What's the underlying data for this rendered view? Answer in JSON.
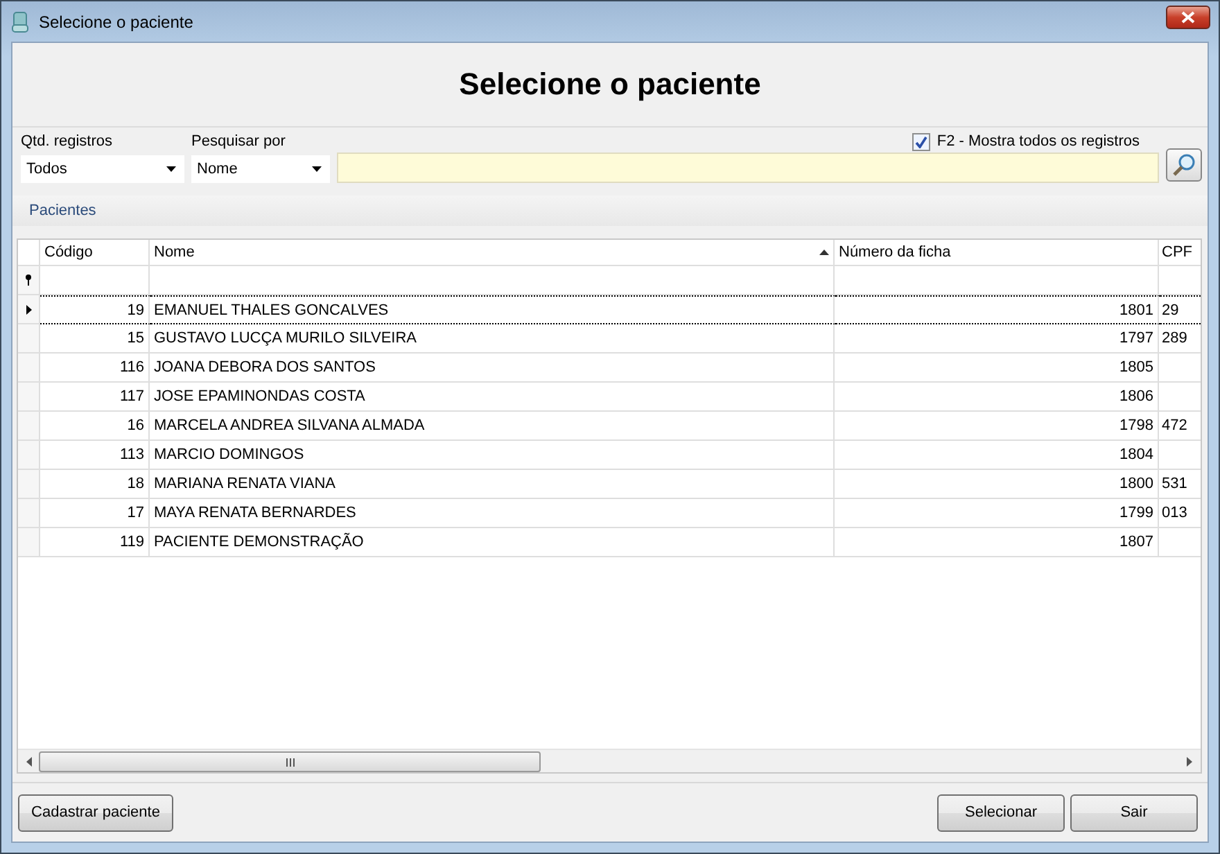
{
  "window": {
    "title": "Selecione o paciente"
  },
  "heading": "Selecione o paciente",
  "filters": {
    "count_label": "Qtd. registros",
    "count_value": "Todos",
    "search_by_label": "Pesquisar por",
    "search_by_value": "Nome",
    "show_all": {
      "label": "F2 - Mostra todos os registros",
      "checked": true
    }
  },
  "group_tab": "Pacientes",
  "table": {
    "columns": [
      {
        "label": "Código",
        "sorted": false
      },
      {
        "label": "Nome",
        "sorted": true
      },
      {
        "label": "Número da ficha",
        "sorted": false
      },
      {
        "label": "CPF",
        "sorted": false
      }
    ],
    "rows": [
      {
        "selected": true,
        "cells": [
          "19",
          "EMANUEL THALES GONCALVES",
          "1801",
          "29"
        ]
      },
      {
        "selected": false,
        "cells": [
          "15",
          "GUSTAVO LUCÇA MURILO SILVEIRA",
          "1797",
          "289"
        ]
      },
      {
        "selected": false,
        "cells": [
          "116",
          "JOANA DEBORA DOS SANTOS",
          "1805",
          ""
        ]
      },
      {
        "selected": false,
        "cells": [
          "117",
          "JOSE EPAMINONDAS COSTA",
          "1806",
          ""
        ]
      },
      {
        "selected": false,
        "cells": [
          "16",
          "MARCELA ANDREA SILVANA ALMADA",
          "1798",
          "472"
        ]
      },
      {
        "selected": false,
        "cells": [
          "113",
          "MARCIO DOMINGOS",
          "1804",
          ""
        ]
      },
      {
        "selected": false,
        "cells": [
          "18",
          "MARIANA RENATA VIANA",
          "1800",
          "531"
        ]
      },
      {
        "selected": false,
        "cells": [
          "17",
          "MAYA RENATA BERNARDES",
          "1799",
          "013"
        ]
      },
      {
        "selected": false,
        "cells": [
          "119",
          "PACIENTE DEMONSTRAÇÃO",
          "1807",
          ""
        ]
      }
    ]
  },
  "buttons": {
    "left": [
      "Cadastrar paciente"
    ],
    "right": [
      "Selecionar",
      "Sair"
    ]
  }
}
